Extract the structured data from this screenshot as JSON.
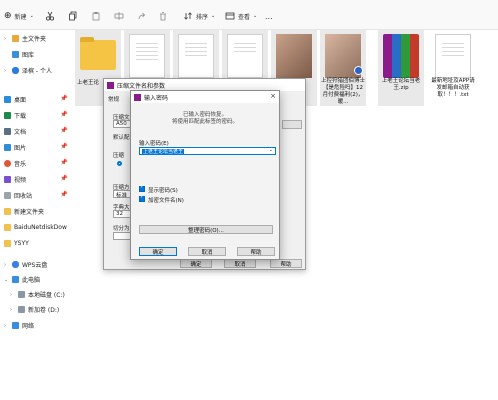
{
  "toolbar": {
    "new_label": "新建",
    "sort_label": "排序",
    "view_label": "查看",
    "more_label": "..."
  },
  "sidebar": {
    "items": [
      {
        "label": "主文件夹",
        "icon": "home-icon"
      },
      {
        "label": "图库",
        "icon": "gallery-icon"
      },
      {
        "label": "泽槟 - 个人",
        "icon": "cloud-icon"
      },
      {
        "label": "桌面",
        "icon": "desktop-icon"
      },
      {
        "label": "下载",
        "icon": "download-icon"
      },
      {
        "label": "文档",
        "icon": "documents-icon"
      },
      {
        "label": "图片",
        "icon": "pictures-icon"
      },
      {
        "label": "音乐",
        "icon": "music-icon"
      },
      {
        "label": "视频",
        "icon": "videos-icon"
      },
      {
        "label": "回收站",
        "icon": "recycle-bin-icon"
      },
      {
        "label": "新建文件夹",
        "icon": "folder-icon"
      },
      {
        "label": "BaiduNetdiskDow",
        "icon": "folder-icon"
      },
      {
        "label": "YSYY",
        "icon": "folder-icon"
      },
      {
        "label": "WPS云盘",
        "icon": "cloud-icon"
      },
      {
        "label": "此电脑",
        "icon": "computer-icon"
      },
      {
        "label": "本地磁盘 (C:)",
        "icon": "drive-icon"
      },
      {
        "label": "新加卷 (D:)",
        "icon": "drive-icon"
      },
      {
        "label": "网络",
        "icon": "network-icon"
      }
    ]
  },
  "files": [
    {
      "label": "",
      "type": "folder"
    },
    {
      "label": "",
      "type": "doc"
    },
    {
      "label": "",
      "type": "doc"
    },
    {
      "label": "",
      "type": "doc"
    },
    {
      "label": "",
      "type": "doc"
    },
    {
      "label": "",
      "type": "video"
    },
    {
      "label": "上控狩猎团伯博士【是危险吗】12月付费福利(2)，暖...",
      "type": "video"
    },
    {
      "label": "上老王论坛当老王.zip",
      "type": "archive"
    },
    {
      "label": "最新地址及APP请发邮箱自动获取！！！.txt",
      "type": "doc"
    }
  ],
  "partial_file_label": "上老王论",
  "back_dialog": {
    "title": "压缩文件名和参数",
    "tab_general": "常规",
    "label_compress": "压缩文",
    "field_value": "A50",
    "label_default": "默认配",
    "label_format": "压缩",
    "label_method": "压缩方",
    "method_value": "标准",
    "label_dict": "字典大",
    "dict_value": "32",
    "label_split": "切分为",
    "ok": "确定",
    "cancel": "取消",
    "help": "帮助"
  },
  "password_dialog": {
    "title": "输入密码",
    "note_line1": "已输入密码恢复。",
    "note_line2": "将使用匹配此标签的密码。",
    "password_label": "输入密码(E)",
    "password_value": "上老王论坛当老王",
    "show_password": "显示密码(S)",
    "encrypt_names": "加密文件名(N)",
    "organize": "整理密码(O)...",
    "ok": "确定",
    "cancel": "取消",
    "help": "帮助"
  }
}
